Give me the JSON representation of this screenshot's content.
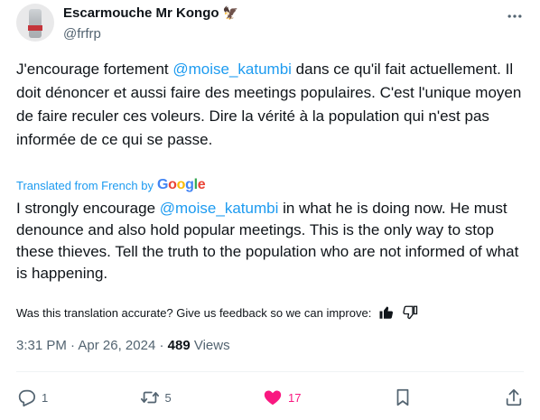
{
  "author": {
    "display_name": "Escarmouche Mr Kongo",
    "handle": "@frfrp",
    "name_emoji": "🦅"
  },
  "tweet": {
    "before_mention": "J'encourage fortement ",
    "mention": "@moise_katumbi",
    "after_mention": " dans ce qu'il fait actuellement. Il doit dénoncer et aussi faire des meetings populaires. C'est l'unique moyen de faire reculer ces voleurs. Dire la vérité à la population qui n'est pas informée de ce qui se passe."
  },
  "translation": {
    "label": "Translated from French by",
    "provider": "Google",
    "before_mention": "I strongly encourage ",
    "mention": "@moise_katumbi",
    "after_mention": " in what he is doing now. He must denounce and also hold popular meetings. This is the only way to stop these thieves. Tell the truth to the population who are not informed of what is happening."
  },
  "feedback": {
    "prompt": "Was this translation accurate? Give us feedback so we can improve:"
  },
  "meta": {
    "time": "3:31 PM",
    "separator": " · ",
    "date": "Apr 26, 2024",
    "separator2": " · ",
    "views_count": "489",
    "views_label": " Views"
  },
  "actions": {
    "replies": "1",
    "reposts": "5",
    "likes": "17"
  },
  "colors": {
    "accent": "#1d9bf0",
    "like": "#f91880",
    "secondary_text": "#536471"
  }
}
